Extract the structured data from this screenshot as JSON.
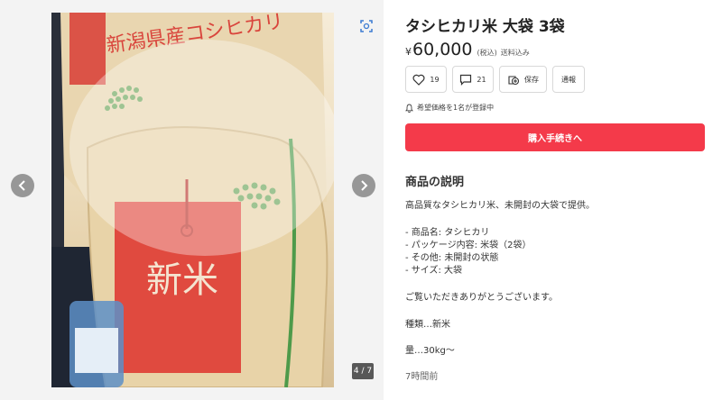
{
  "gallery": {
    "counter": "4 / 7",
    "prev_icon": "chevron-left-icon",
    "next_icon": "chevron-right-icon",
    "zoom_icon": "zoom-icon",
    "photo_lettering": [
      "新潟県産コシヒカリ",
      "新米"
    ]
  },
  "item": {
    "title": "タシヒカリ米 大袋 3袋",
    "currency": "¥",
    "price": "60,000",
    "tax_label": "(税込)",
    "shipping_label": "送料込み"
  },
  "actions": {
    "like_count": "19",
    "comment_count": "21",
    "save_label": "保存",
    "report_label": "通報"
  },
  "notice": {
    "text": "希望価格を1名が登録中"
  },
  "buy_button": {
    "label": "購入手続きへ",
    "color": "#f43a4a"
  },
  "description": {
    "heading": "商品の説明",
    "lines": [
      "高品質なタシヒカリ米、未開封の大袋で提供。",
      "- 商品名: タシヒカリ",
      "- パッケージ内容: 米袋（2袋）",
      "- その他: 未開封の状態",
      "- サイズ: 大袋",
      "ご覧いただきありがとうございます。",
      "種類…新米",
      "量…30kg〜"
    ],
    "posted": "7時間前"
  }
}
